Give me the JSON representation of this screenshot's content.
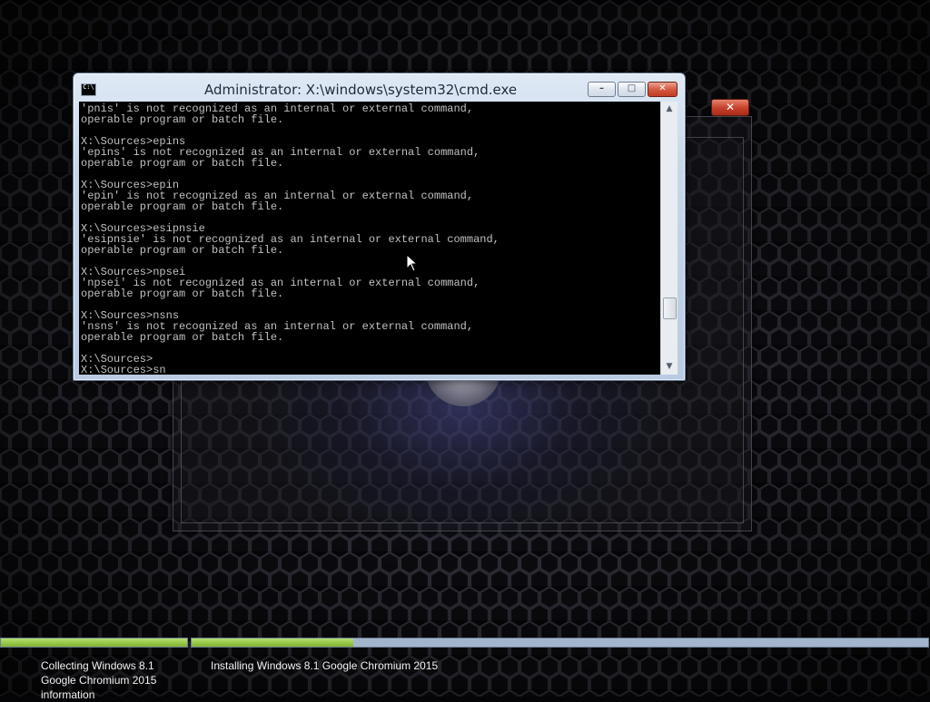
{
  "desktop": {
    "background": "dark-honeycomb-mesh",
    "glow_color": "#7878ff"
  },
  "setup_dialog": {
    "close_label": "✕",
    "accent": "#c4402a"
  },
  "cmd_window": {
    "title": "Administrator: X:\\windows\\system32\\cmd.exe",
    "minimize_label": "–",
    "maximize_label": "□",
    "close_label": "✕",
    "console_background": "#000000",
    "console_text_color": "#c0c0c0",
    "lines": [
      "'pnis' is not recognized as an internal or external command,",
      "operable program or batch file.",
      "",
      "X:\\Sources>epins",
      "'epins' is not recognized as an internal or external command,",
      "operable program or batch file.",
      "",
      "X:\\Sources>epin",
      "'epin' is not recognized as an internal or external command,",
      "operable program or batch file.",
      "",
      "X:\\Sources>esipnsie",
      "'esipnsie' is not recognized as an internal or external command,",
      "operable program or batch file.",
      "",
      "X:\\Sources>npsei",
      "'npsei' is not recognized as an internal or external command,",
      "operable program or batch file.",
      "",
      "X:\\Sources>nsns",
      "'nsns' is not recognized as an internal or external command,",
      "operable program or batch file.",
      "",
      "X:\\Sources>",
      "X:\\Sources>sn"
    ],
    "scrollbar": {
      "up_icon": "chevron-up-icon",
      "down_icon": "chevron-down-icon",
      "position_fraction": 0.82
    }
  },
  "setup_progress": {
    "steps": [
      {
        "label": "Collecting Windows 8.1 Google Chromium 2015 information",
        "progress": 1.0
      },
      {
        "label": "Installing Windows 8.1 Google Chromium 2015",
        "progress": 0.22
      }
    ],
    "fill_color": "#8cc63f",
    "track_color": "#a3b5cc"
  }
}
